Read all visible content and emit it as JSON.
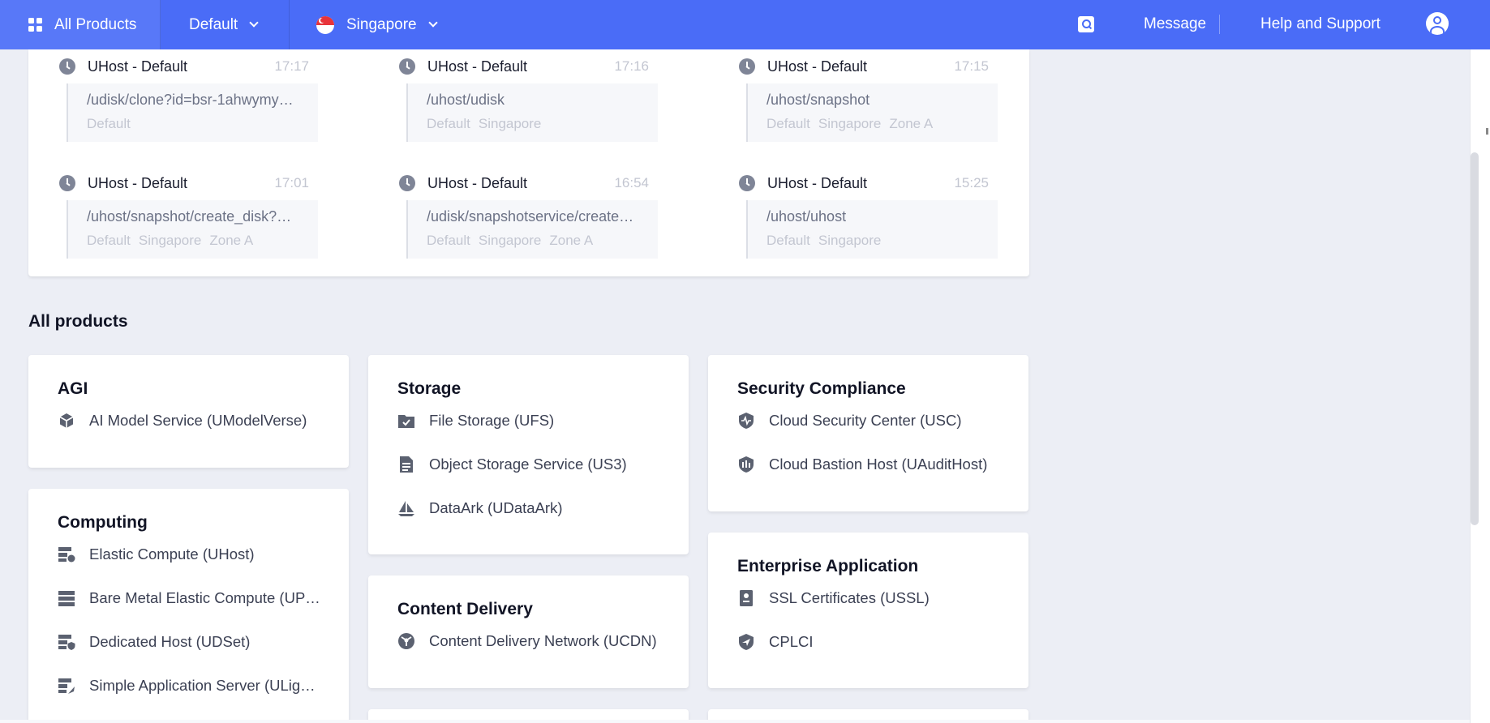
{
  "topbar": {
    "all_products": "All Products",
    "project": "Default",
    "region": "Singapore",
    "message": "Message",
    "help": "Help and Support"
  },
  "recent": [
    {
      "title": "UHost - Default",
      "time": "17:17",
      "path": "/udisk/clone?id=bsr-1ahwymy…",
      "tags": [
        "Default"
      ]
    },
    {
      "title": "UHost - Default",
      "time": "17:16",
      "path": "/uhost/udisk",
      "tags": [
        "Default",
        "Singapore"
      ]
    },
    {
      "title": "UHost - Default",
      "time": "17:15",
      "path": "/uhost/snapshot",
      "tags": [
        "Default",
        "Singapore",
        "Zone A"
      ]
    },
    {
      "title": "UHost - Default",
      "time": "17:01",
      "path": "/uhost/snapshot/create_disk?…",
      "tags": [
        "Default",
        "Singapore",
        "Zone A"
      ]
    },
    {
      "title": "UHost - Default",
      "time": "16:54",
      "path": "/udisk/snapshotservice/create…",
      "tags": [
        "Default",
        "Singapore",
        "Zone A"
      ]
    },
    {
      "title": "UHost - Default",
      "time": "15:25",
      "path": "/uhost/uhost",
      "tags": [
        "Default",
        "Singapore"
      ]
    }
  ],
  "products_title": "All products",
  "categories": {
    "agi": {
      "title": "AGI",
      "items": [
        "AI Model Service (UModelVerse)"
      ]
    },
    "computing": {
      "title": "Computing",
      "items": [
        "Elastic Compute (UHost)",
        "Bare Metal Elastic Compute (UP…",
        "Dedicated Host (UDSet)",
        "Simple Application Server (ULigh…"
      ]
    },
    "storage": {
      "title": "Storage",
      "items": [
        "File Storage (UFS)",
        "Object Storage Service (US3)",
        "DataArk (UDataArk)"
      ]
    },
    "cdn": {
      "title": "Content Delivery",
      "items": [
        "Content Delivery Network (UCDN)"
      ]
    },
    "security": {
      "title": "Security Compliance",
      "items": [
        "Cloud Security Center (USC)",
        "Cloud Bastion Host (UAuditHost)"
      ]
    },
    "enterprise": {
      "title": "Enterprise Application",
      "items": [
        "SSL Certificates (USSL)",
        "CPLCI"
      ]
    }
  },
  "colors": {
    "topbar": "#4a6cf7",
    "background": "#eceef5",
    "icon": "#5b6170"
  }
}
